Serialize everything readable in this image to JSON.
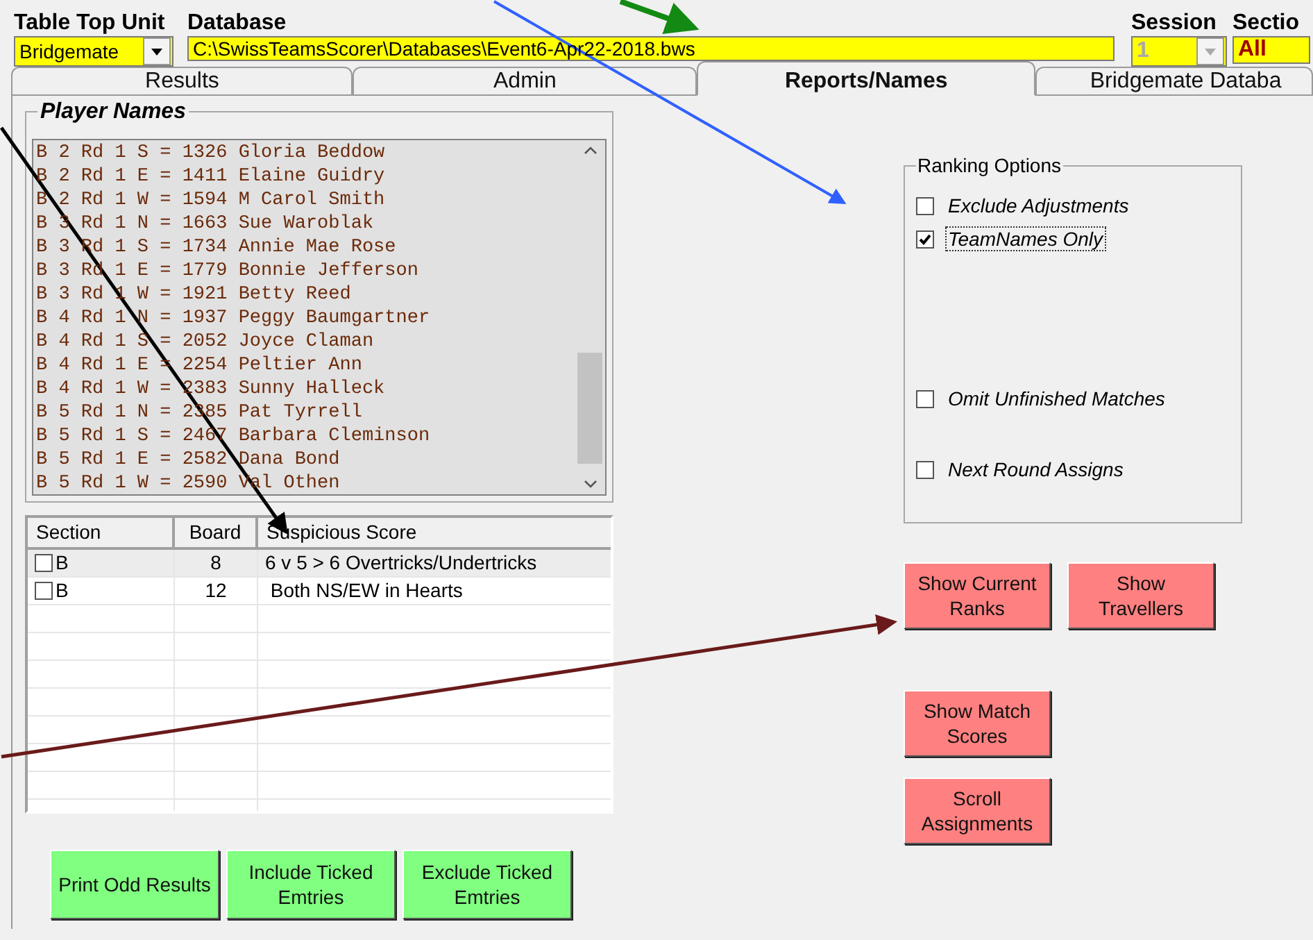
{
  "header": {
    "table_top_unit": {
      "label": "Table Top Unit",
      "value": "Bridgemate"
    },
    "database": {
      "label": "Database",
      "value": "C:\\SwissTeamsScorer\\Databases\\Event6-Apr22-2018.bws"
    },
    "session": {
      "label": "Session",
      "value": "1",
      "disabled": true
    },
    "section": {
      "label": "Sectio",
      "value": "All"
    }
  },
  "tabs": [
    {
      "label": "Results",
      "selected": false
    },
    {
      "label": "Admin",
      "selected": false
    },
    {
      "label": "Reports/Names",
      "selected": true
    },
    {
      "label": "Bridgemate Databa",
      "selected": false
    }
  ],
  "player_names": {
    "title": "Player Names",
    "lines": [
      "B 2 Rd 1 S = 1326 Gloria Beddow",
      "B 2 Rd 1 E = 1411 Elaine Guidry",
      "B 2 Rd 1 W = 1594 M Carol Smith",
      "B 3 Rd 1 N = 1663 Sue Waroblak",
      "B 3 Rd 1 S = 1734 Annie Mae Rose",
      "B 3 Rd 1 E = 1779 Bonnie Jefferson",
      "B 3 Rd 1 W = 1921 Betty Reed",
      "B 4 Rd 1 N = 1937 Peggy Baumgartner",
      "B 4 Rd 1 S = 2052 Joyce Claman",
      "B 4 Rd 1 E = 2254 Peltier Ann",
      "B 4 Rd 1 W = 2383 Sunny Halleck",
      "B 5 Rd 1 N = 2385 Pat Tyrrell",
      "B 5 Rd 1 S = 2467 Barbara Cleminson",
      "B 5 Rd 1 E = 2582 Dana Bond",
      "B 5 Rd 1 W = 2590 Val Othen"
    ]
  },
  "suspicious_scores": {
    "columns": [
      "Section",
      "Board",
      "Suspicious Score"
    ],
    "rows": [
      {
        "section": "B",
        "board": "8",
        "score": "6 v 5 > 6 Overtricks/Undertricks",
        "checked": false,
        "selected": true
      },
      {
        "section": "B",
        "board": "12",
        "score": " Both NS/EW in Hearts",
        "checked": false,
        "selected": false
      }
    ]
  },
  "actions": [
    "Print Odd Results",
    "Include Ticked Emtries",
    "Exclude Ticked Emtries"
  ],
  "ranking_options": {
    "title": "Ranking Options",
    "options": [
      {
        "label": "Exclude Adjustments",
        "checked": false,
        "focused": false
      },
      {
        "label": "TeamNames Only",
        "checked": true,
        "focused": true
      },
      {
        "label": "Omit Unfinished Matches",
        "checked": false,
        "focused": false
      },
      {
        "label": "Next Round Assigns",
        "checked": false,
        "focused": false
      }
    ]
  },
  "report_buttons": [
    {
      "buttons": [
        "Show Current Ranks",
        "Show Travellers"
      ]
    },
    {
      "buttons": [
        "Show Match Scores"
      ]
    },
    {
      "buttons": [
        "Scroll Assignments"
      ]
    }
  ]
}
